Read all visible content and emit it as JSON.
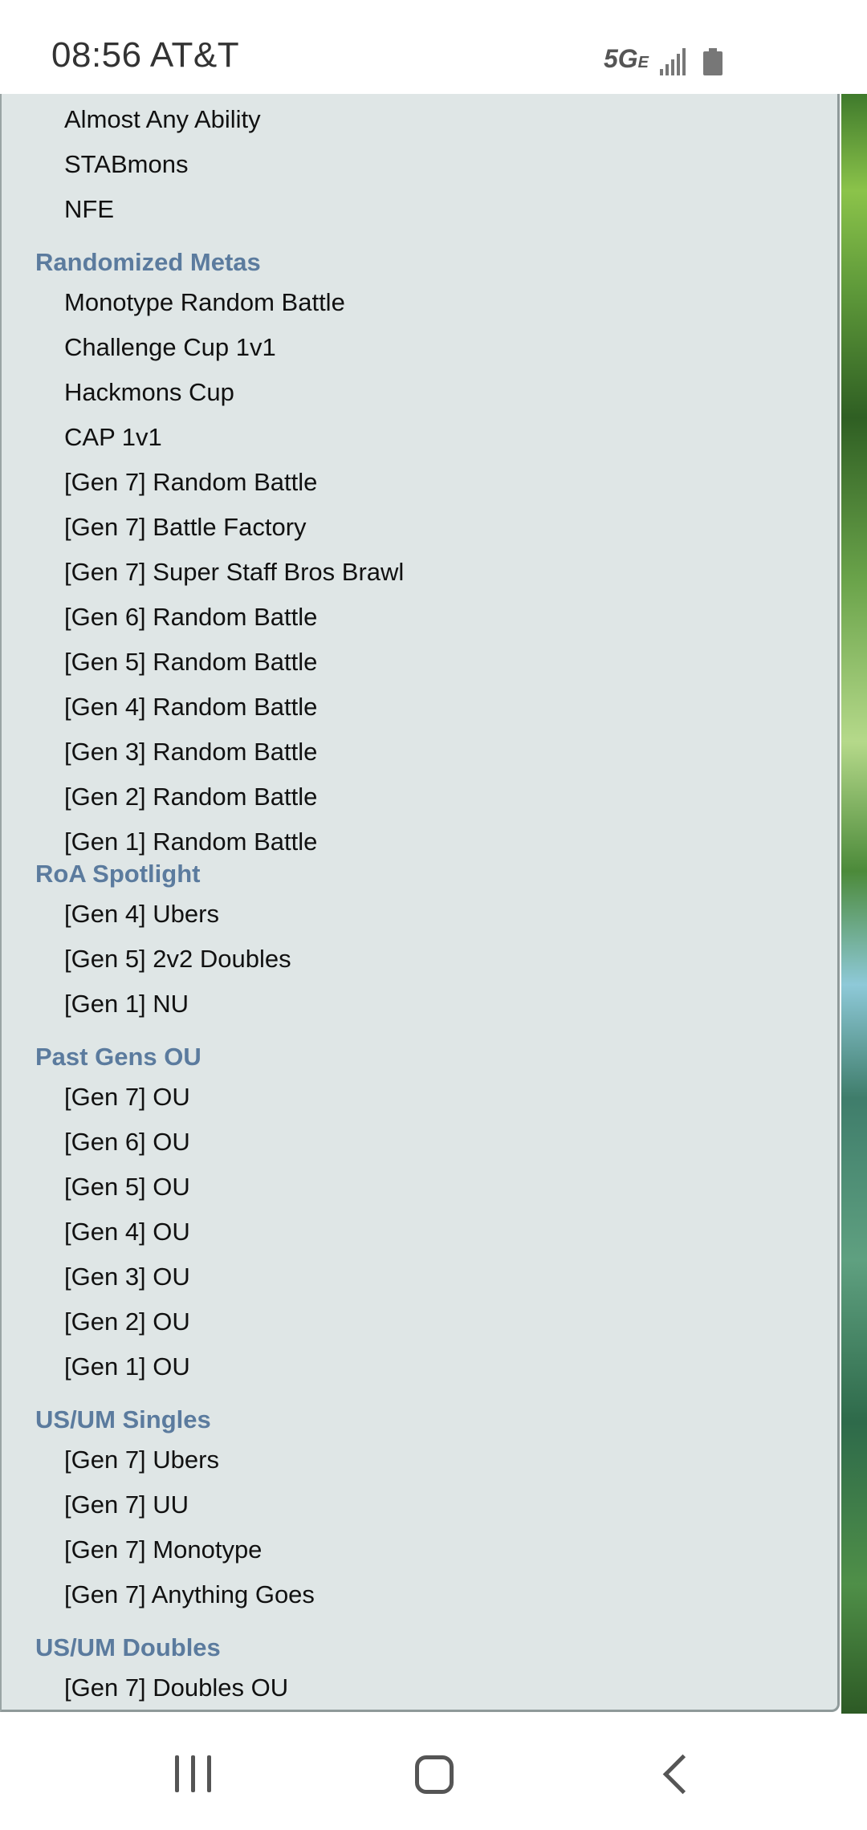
{
  "status_bar": {
    "time": "08:56 AT&T",
    "network": "5G",
    "network_suffix": "E"
  },
  "format_menu": {
    "top_items": [
      "Almost Any Ability",
      "STABmons",
      "NFE"
    ],
    "sections": [
      {
        "title": "Randomized Metas",
        "items": [
          "Monotype Random Battle",
          "Challenge Cup 1v1",
          "Hackmons Cup",
          "CAP 1v1",
          "[Gen 7] Random Battle",
          "[Gen 7] Battle Factory",
          "[Gen 7] Super Staff Bros Brawl",
          "[Gen 6] Random Battle",
          "[Gen 5] Random Battle",
          "[Gen 4] Random Battle",
          "[Gen 3] Random Battle",
          "[Gen 2] Random Battle",
          "[Gen 1] Random Battle"
        ]
      },
      {
        "title": "RoA Spotlight",
        "items": [
          "[Gen 4] Ubers",
          "[Gen 5] 2v2 Doubles",
          "[Gen 1] NU"
        ]
      },
      {
        "title": "Past Gens OU",
        "items": [
          "[Gen 7] OU",
          "[Gen 6] OU",
          "[Gen 5] OU",
          "[Gen 4] OU",
          "[Gen 3] OU",
          "[Gen 2] OU",
          "[Gen 1] OU"
        ]
      },
      {
        "title": "US/UM Singles",
        "items": [
          "[Gen 7] Ubers",
          "[Gen 7] UU",
          "[Gen 7] Monotype",
          "[Gen 7] Anything Goes"
        ]
      },
      {
        "title": "US/UM Doubles",
        "items": [
          "[Gen 7] Doubles OU"
        ]
      }
    ]
  },
  "nav_bar": {
    "recents_icon": "recents-icon",
    "home_icon": "home-icon",
    "back_icon": "back-icon"
  }
}
